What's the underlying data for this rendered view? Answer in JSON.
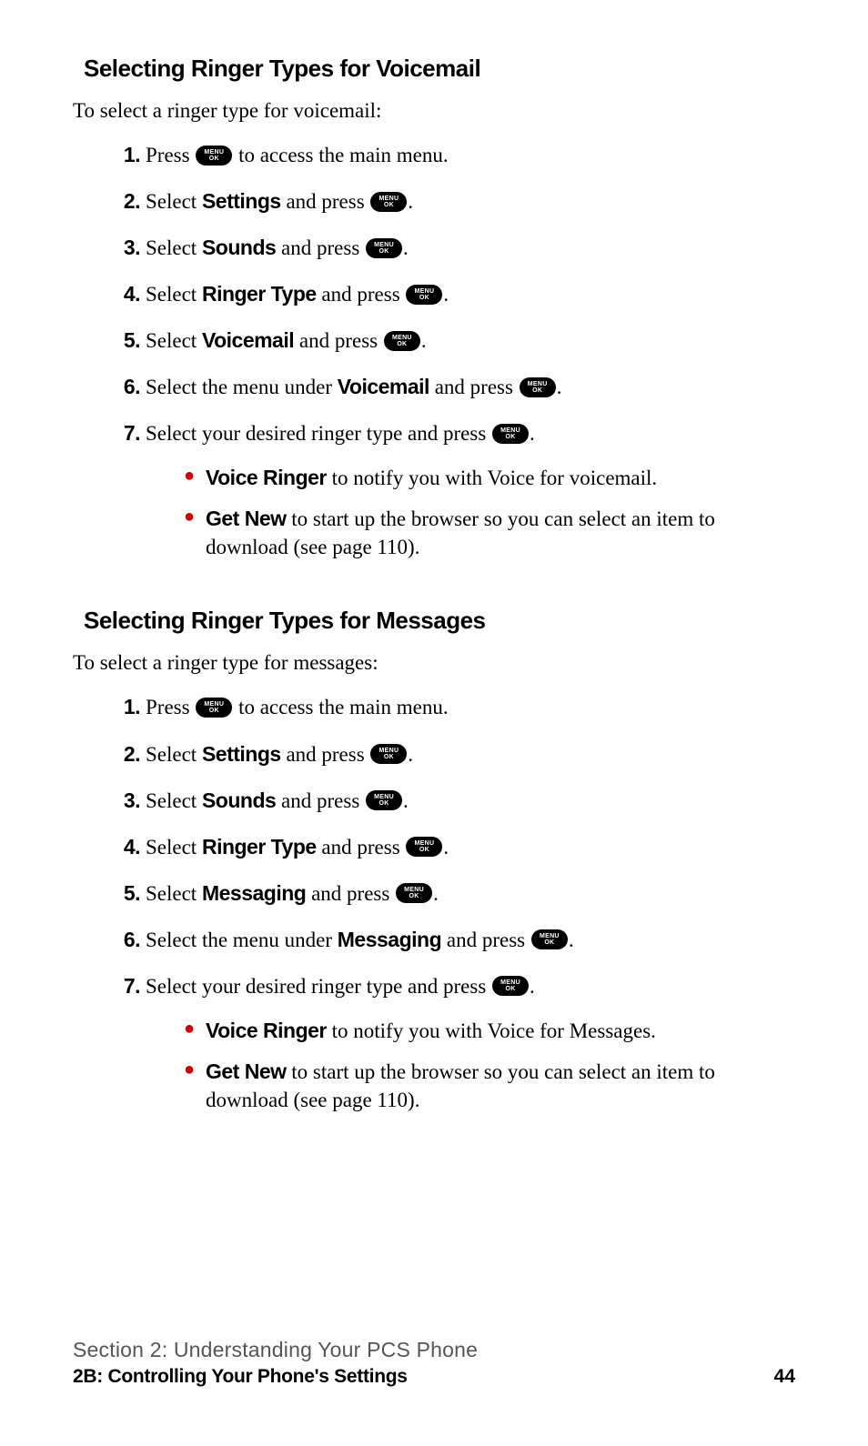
{
  "button": {
    "line1": "MENU",
    "line2": "OK"
  },
  "sections": [
    {
      "heading": "Selecting Ringer Types for Voicemail",
      "intro": "To select a ringer type for voicemail:",
      "steps": [
        {
          "num": "1.",
          "before": "Press ",
          "after": " to access the main menu."
        },
        {
          "num": "2.",
          "before": "Select ",
          "bold": "Settings",
          "mid": " and press ",
          "after": "."
        },
        {
          "num": "3.",
          "before": "Select ",
          "bold": "Sounds",
          "mid": " and press ",
          "after": "."
        },
        {
          "num": "4.",
          "before": "Select ",
          "bold": "Ringer Type",
          "mid": " and press ",
          "after": "."
        },
        {
          "num": "5.",
          "before": "Select ",
          "bold": "Voicemail",
          "mid": " and press ",
          "after": "."
        },
        {
          "num": "6.",
          "before": "Select the menu under ",
          "bold": "Voicemail",
          "mid": " and press ",
          "after": "."
        },
        {
          "num": "7.",
          "before": "Select your desired ringer type and press ",
          "after": ".",
          "subs": [
            {
              "bold": "Voice Ringer",
              "text": " to notify you with Voice for voicemail."
            },
            {
              "bold": "Get New",
              "text": " to start up the browser so you can select an item to download (see page 110)."
            }
          ]
        }
      ]
    },
    {
      "heading": "Selecting Ringer Types for Messages",
      "intro": "To select a ringer type for messages:",
      "steps": [
        {
          "num": "1.",
          "before": "Press ",
          "after": " to access the main menu."
        },
        {
          "num": "2.",
          "before": "Select ",
          "bold": "Settings",
          "mid": " and press ",
          "after": "."
        },
        {
          "num": "3.",
          "before": "Select ",
          "bold": "Sounds",
          "mid": " and press ",
          "after": "."
        },
        {
          "num": "4.",
          "before": "Select ",
          "bold": "Ringer Type",
          "mid": " and press ",
          "after": "."
        },
        {
          "num": "5.",
          "before": "Select ",
          "bold": "Messaging",
          "mid": " and press ",
          "after": "."
        },
        {
          "num": "6.",
          "before": "Select the menu under ",
          "bold": "Messaging",
          "mid": " and press ",
          "after": "."
        },
        {
          "num": "7.",
          "before": "Select your desired ringer type and press ",
          "after": ".",
          "subs": [
            {
              "bold": "Voice Ringer",
              "text": " to notify you with Voice for Messages."
            },
            {
              "bold": "Get New",
              "text": " to start up the browser so you can select an item to download (see page 110)."
            }
          ]
        }
      ]
    }
  ],
  "footer": {
    "line1": "Section 2: Understanding Your PCS Phone",
    "line2": "2B: Controlling Your Phone's Settings",
    "page": "44"
  }
}
